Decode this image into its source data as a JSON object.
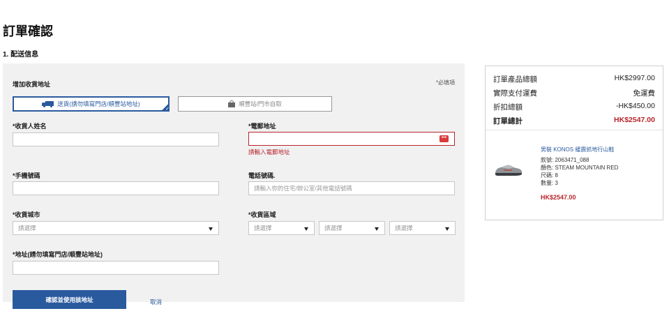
{
  "page": {
    "title": "訂單確認",
    "section": "1. 配送信息"
  },
  "form": {
    "heading": "增加收貨地址",
    "required_note": "*必填項",
    "ship_delivery_label": "送貨(請勿填寫門店/順豐站地址)",
    "ship_pickup_label": "順豐站/門市自取",
    "recipient_name_label": "*收貨人姓名",
    "recipient_name_value": "",
    "email_label": "*電郵地址",
    "email_value": "",
    "email_error": "請輸入電郵地址",
    "mobile_label": "*手機號碼",
    "mobile_value": "",
    "phone_label": "電話號碼.",
    "phone_placeholder": "請輸入你的住宅/辦公室/其他電話號碼",
    "city_label": "*收貨城市",
    "city_select": "請選擇",
    "district_label": "*收貨區域",
    "district_select_1": "請選擇",
    "district_select_2": "請選擇",
    "district_select_3": "請選擇",
    "address_label": "*地址(請勿填寫門店/順豐站地址)",
    "address_value": "",
    "confirm_label": "確認並使用該地址",
    "cancel_label": "取消"
  },
  "summary": {
    "subtotal_label": "訂單產品總額",
    "subtotal_value": "HK$2997.00",
    "shipping_label": "實際支付運費",
    "shipping_value": "免運費",
    "discount_label": "折扣總額",
    "discount_value": "-HK$450.00",
    "total_label": "訂單總計",
    "total_value": "HK$2547.00"
  },
  "product": {
    "name": "男裝 KONOS 緩震抓地行山鞋",
    "sku_label": "款號:",
    "sku": "2063471_088",
    "color_label": "顏色:",
    "color": "STEAM MOUNTAIN RED",
    "size_label": "尺碼:",
    "size": "8",
    "qty_label": "數量:",
    "qty": "3",
    "price": "HK$2547.00"
  },
  "colors": {
    "accent": "#2a5a9e",
    "error": "#b7252c",
    "panel": "#f1f1f1"
  }
}
